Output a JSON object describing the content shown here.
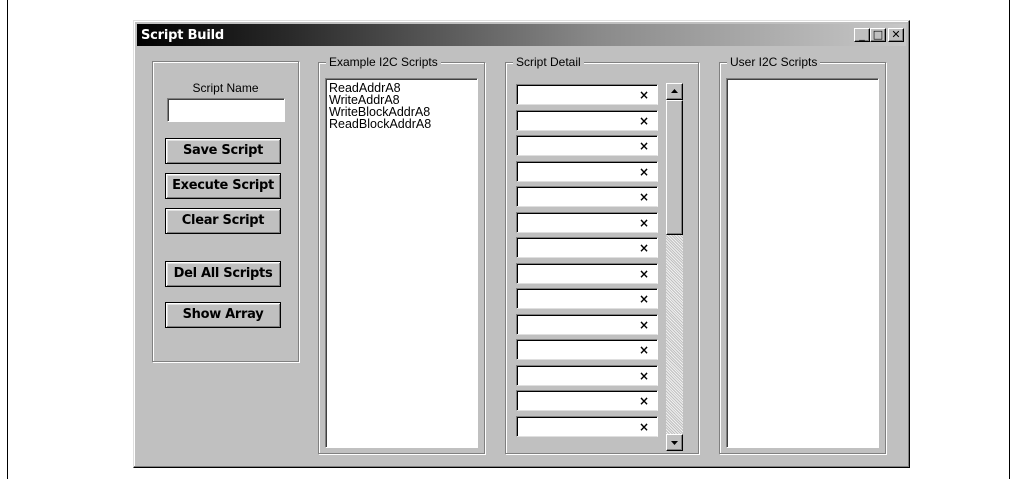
{
  "window": {
    "title": "Script Build",
    "minimize_glyph": "_",
    "maximize_glyph": "□",
    "close_glyph": "✕"
  },
  "left_panel": {
    "script_name_label": "Script Name",
    "script_name_value": "",
    "buttons": {
      "save": "Save Script",
      "execute": "Execute Script",
      "clear": "Clear Script",
      "del_all": "Del All Scripts",
      "show_array": "Show Array"
    }
  },
  "example_scripts": {
    "title": "Example I2C Scripts",
    "items": [
      "ReadAddrA8",
      "WriteAddrA8",
      "WriteBlockAddrA8",
      "ReadBlockAddrA8"
    ]
  },
  "script_detail": {
    "title": "Script Detail",
    "rows": [
      "",
      "",
      "",
      "",
      "",
      "",
      "",
      "",
      "",
      "",
      "",
      "",
      "",
      ""
    ],
    "row_marker": "×",
    "scroll_up_icon": "▲",
    "scroll_down_icon": "▼"
  },
  "user_scripts": {
    "title": "User I2C Scripts",
    "items": []
  }
}
